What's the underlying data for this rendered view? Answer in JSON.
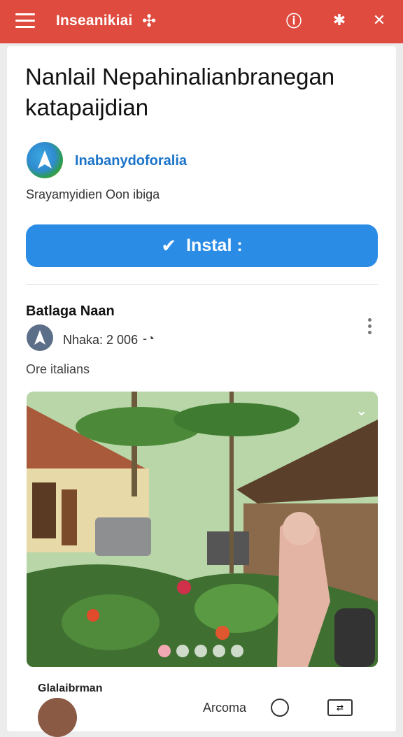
{
  "header": {
    "brand": "Inseanikiai",
    "icons": [
      "menu-icon",
      "brand-pin-icon",
      "alert-icon",
      "puzzle-icon",
      "close-icon"
    ]
  },
  "app": {
    "title": "Nanlail Nepahinalianbranegan katapaijdian",
    "name": "Inabanydoforalia",
    "subline": "Srayamyidien Oon ibiga",
    "install_label": "Instal :"
  },
  "post": {
    "section_title": "Batlaga Naan",
    "meta": "Nhaka: 2 006",
    "caption": "Ore italians",
    "carousel": {
      "count": 5,
      "active_index": 0
    }
  },
  "footer": {
    "label": "Glalaibrman",
    "right_text": "Arcoma"
  },
  "colors": {
    "topbar": "#df4b3e",
    "install": "#2b8ce6",
    "appname": "#1a73c8"
  }
}
